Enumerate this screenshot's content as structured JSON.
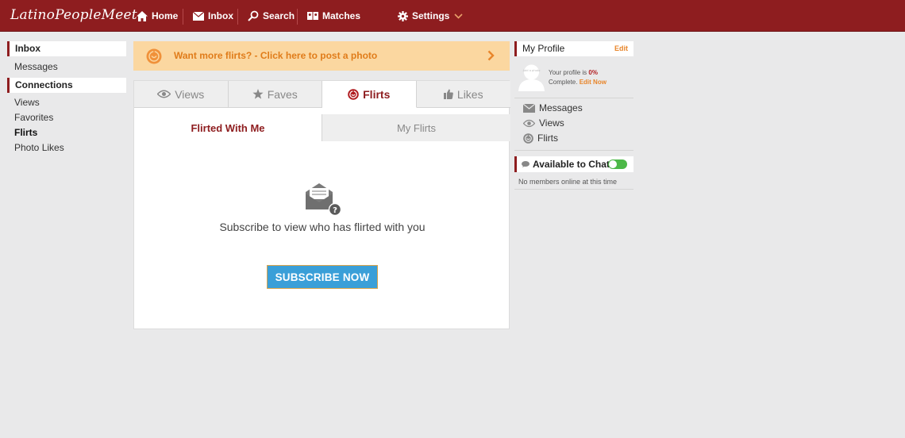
{
  "app": {
    "title": "LatinoPeopleMeet"
  },
  "nav": {
    "home": "Home",
    "inbox": "Inbox",
    "search": "Search",
    "matches": "Matches",
    "settings": "Settings"
  },
  "sidebar": {
    "inbox_header": "Inbox",
    "messages": "Messages",
    "connections_header": "Connections",
    "views": "Views",
    "favorites": "Favorites",
    "flirts": "Flirts",
    "photo_likes": "Photo Likes",
    "active_item": "Flirts"
  },
  "banner": {
    "text": "Want more flirts? - Click here to post a photo"
  },
  "tabs": [
    {
      "label": "Views",
      "icon": "eye-icon"
    },
    {
      "label": "Faves",
      "icon": "star-icon"
    },
    {
      "label": "Flirts",
      "icon": "flirt-icon",
      "active": true
    },
    {
      "label": "Likes",
      "icon": "thumbs-up-icon"
    }
  ],
  "subtabs": {
    "flirted_with_me": "Flirted With Me",
    "my_flirts": "My Flirts",
    "active": "Flirted With Me"
  },
  "empty_state": {
    "icon": "envelope-question-icon",
    "message": "Subscribe to view who has flirted with you",
    "button": "SUBSCRIBE NOW"
  },
  "profile": {
    "header": "My Profile",
    "edit": "Edit",
    "avatar_label": "Add a photo",
    "completion_prefix": "Your profile is ",
    "completion_percent": "0%",
    "completion_suffix": "Complete.",
    "edit_now": "Edit Now",
    "links": {
      "messages": "Messages",
      "views": "Views",
      "flirts": "Flirts"
    }
  },
  "chat": {
    "header": "Available to Chat",
    "toggle_on": true,
    "status": "No members online at this time"
  },
  "colors": {
    "brand": "#8e1d1f",
    "accent_orange": "#e07c1a",
    "banner_bg": "#fbd7a0",
    "button_blue": "#3a9fd8",
    "toggle_green": "#4cb848"
  }
}
